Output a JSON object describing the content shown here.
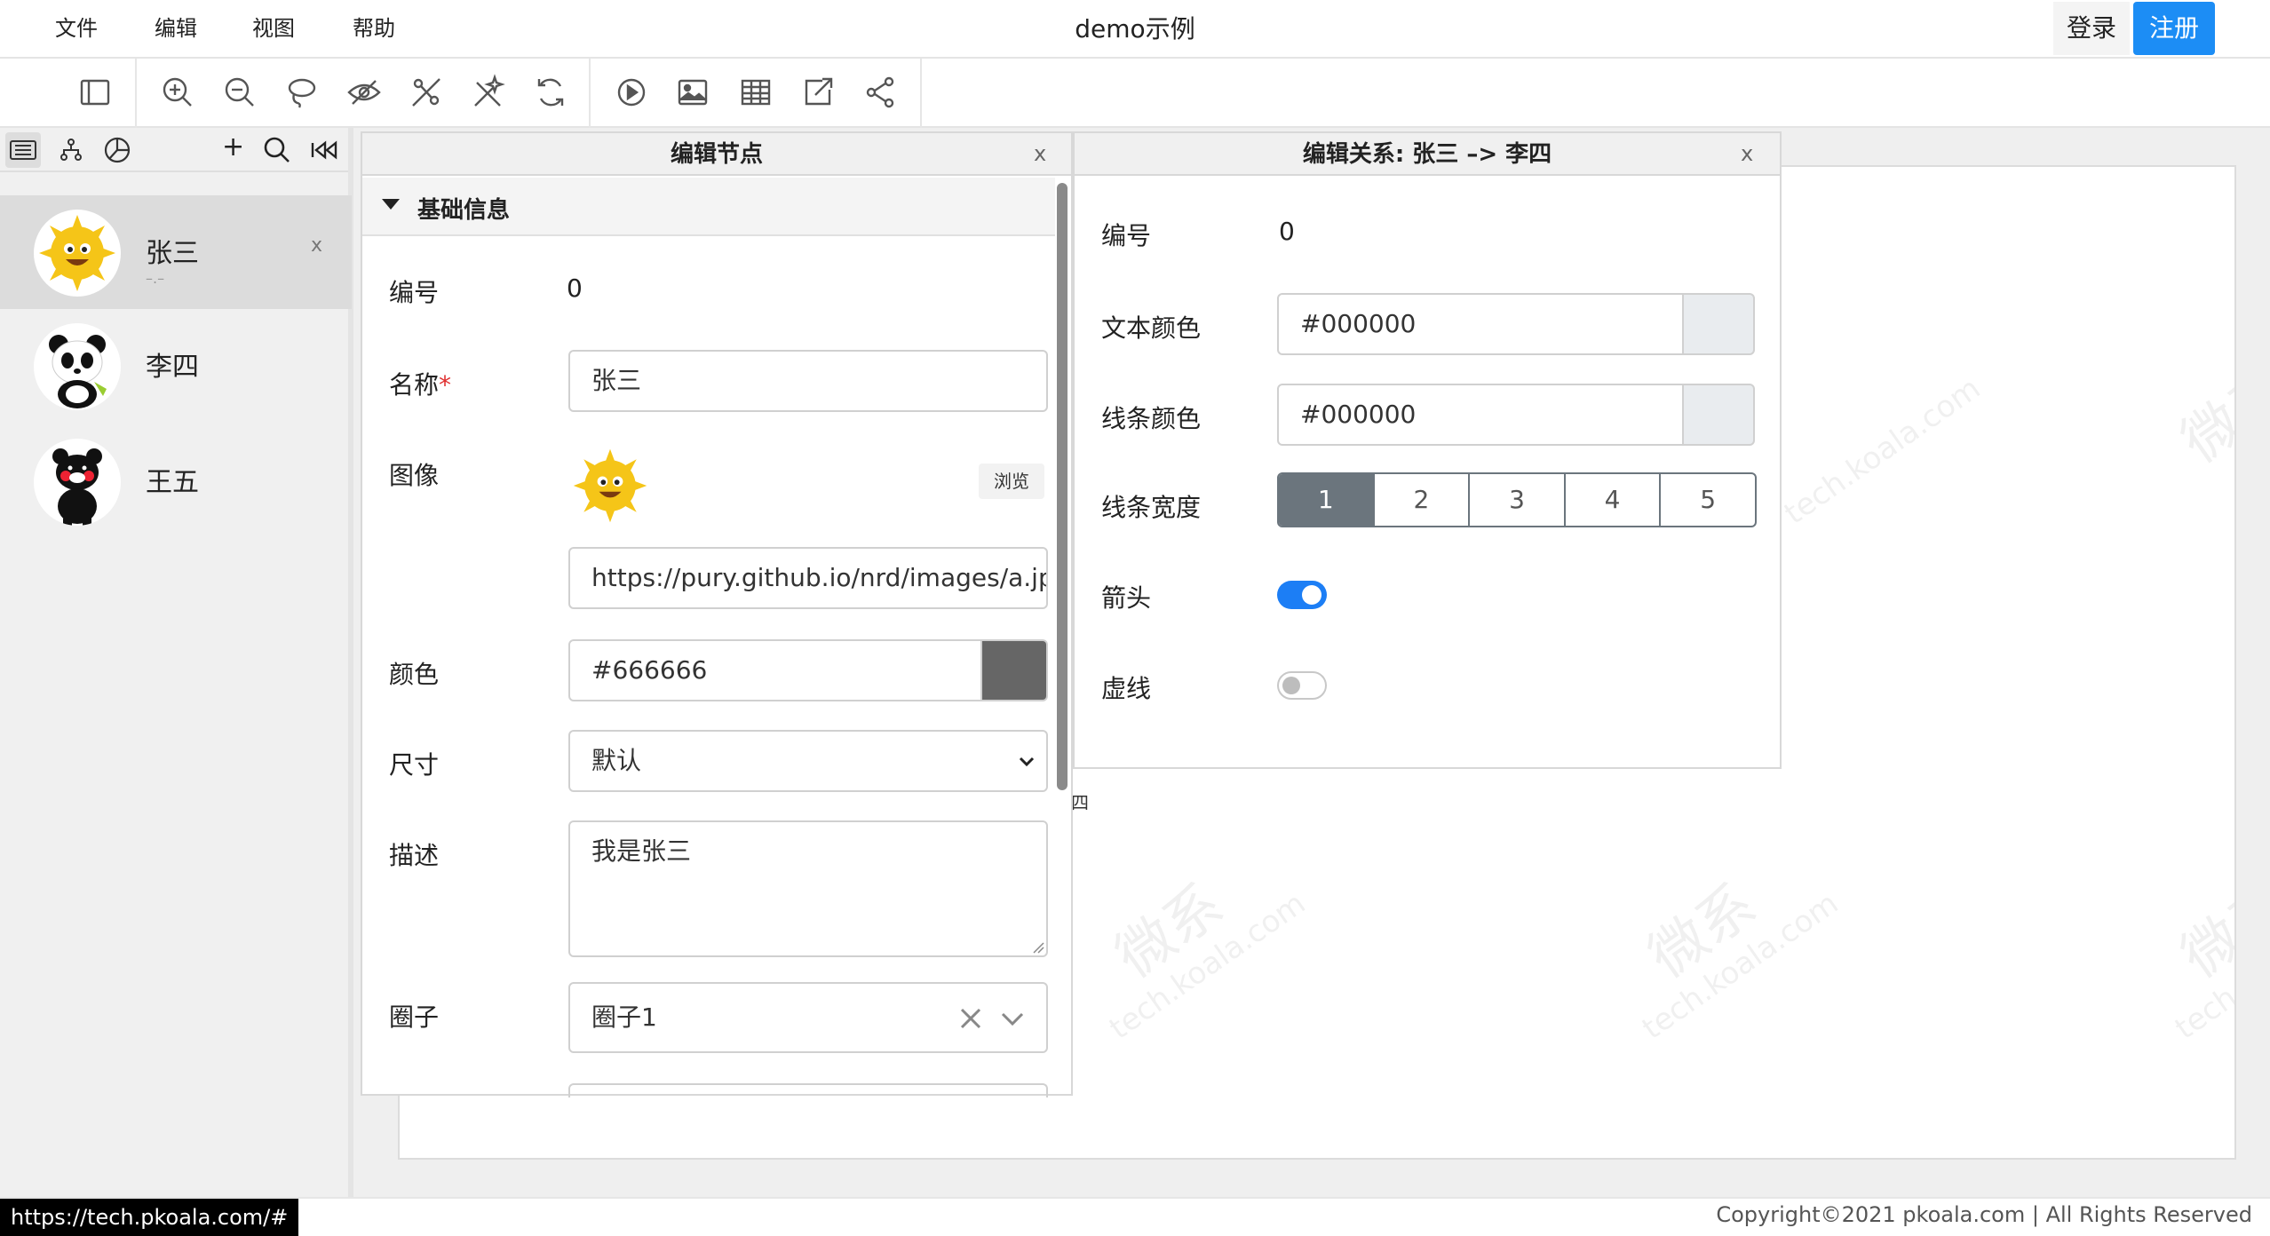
{
  "menu": {
    "file": "文件",
    "edit": "编辑",
    "view": "视图",
    "help": "帮助"
  },
  "app_title": "demo示例",
  "auth": {
    "login": "登录",
    "register": "注册"
  },
  "toolbar_icons": [
    "sidebar-toggle-icon",
    "zoom-in-icon",
    "zoom-out-icon",
    "lasso-icon",
    "hide-icon",
    "hide-edges-icon",
    "magic-icon",
    "refresh-icon",
    "play-icon",
    "image-icon",
    "table-icon",
    "export-icon",
    "share-icon"
  ],
  "sidebar": {
    "tools": {
      "add": "+"
    },
    "nodes": [
      {
        "name": "张三",
        "sub": "–.–",
        "close": "x"
      },
      {
        "name": "李四"
      },
      {
        "name": "王五"
      }
    ]
  },
  "edit_node": {
    "title": "编辑节点",
    "close": "x",
    "section": "基础信息",
    "id_label": "编号",
    "id_value": "0",
    "name_label": "名称",
    "required_mark": "*",
    "name_value": "张三",
    "image_label": "图像",
    "browse": "浏览",
    "image_url": "https://pury.github.io/nrd/images/a.jpg",
    "color_label": "颜色",
    "color_value": "#666666",
    "color_swatch": "#666666",
    "size_label": "尺寸",
    "size_value": "默认",
    "desc_label": "描述",
    "desc_value": "我是张三",
    "circle_label": "圈子",
    "circle_value": "圈子1"
  },
  "edit_relation": {
    "title": "编辑关系: 张三 –> 李四",
    "close": "x",
    "id_label": "编号",
    "id_value": "0",
    "text_color_label": "文本颜色",
    "text_color_value": "#000000",
    "line_color_label": "线条颜色",
    "line_color_value": "#000000",
    "line_width_label": "线条宽度",
    "line_widths": [
      "1",
      "2",
      "3",
      "4",
      "5"
    ],
    "line_width_selected": "1",
    "arrow_label": "箭头",
    "arrow_on": true,
    "dashed_label": "虚线",
    "dashed_on": false
  },
  "canvas": {
    "partial_label": "四",
    "watermark_main": "微系",
    "watermark_sub": "tech.koala.com"
  },
  "colors": {
    "accent": "#1c8df5",
    "selected_width_bg": "#6b757d"
  },
  "status_url": "https://tech.pkoala.com/#",
  "copyright": "Copyright©2021 pkoala.com | All Rights Reserved"
}
